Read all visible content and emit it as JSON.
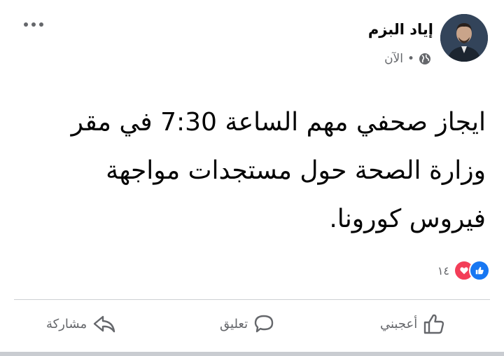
{
  "post": {
    "author": "إياد البزم",
    "timestamp": "الآن",
    "separator": "•",
    "visibility_icon": "globe-icon",
    "text_lines": [
      "ايجاز صحفي مهم الساعة 7:30 في مقر",
      "وزارة الصحة حول مستجدات مواجهة",
      "فيروس كورونا."
    ]
  },
  "reactions": {
    "icons": [
      "like-reaction-icon",
      "love-reaction-icon"
    ],
    "count": "١٤"
  },
  "actions": {
    "like_label": "أعجبني",
    "comment_label": "تعليق",
    "share_label": "مشاركة"
  },
  "colors": {
    "like_blue": "#1877f2",
    "love_red": "#f33e58",
    "secondary_text": "#65676b"
  }
}
